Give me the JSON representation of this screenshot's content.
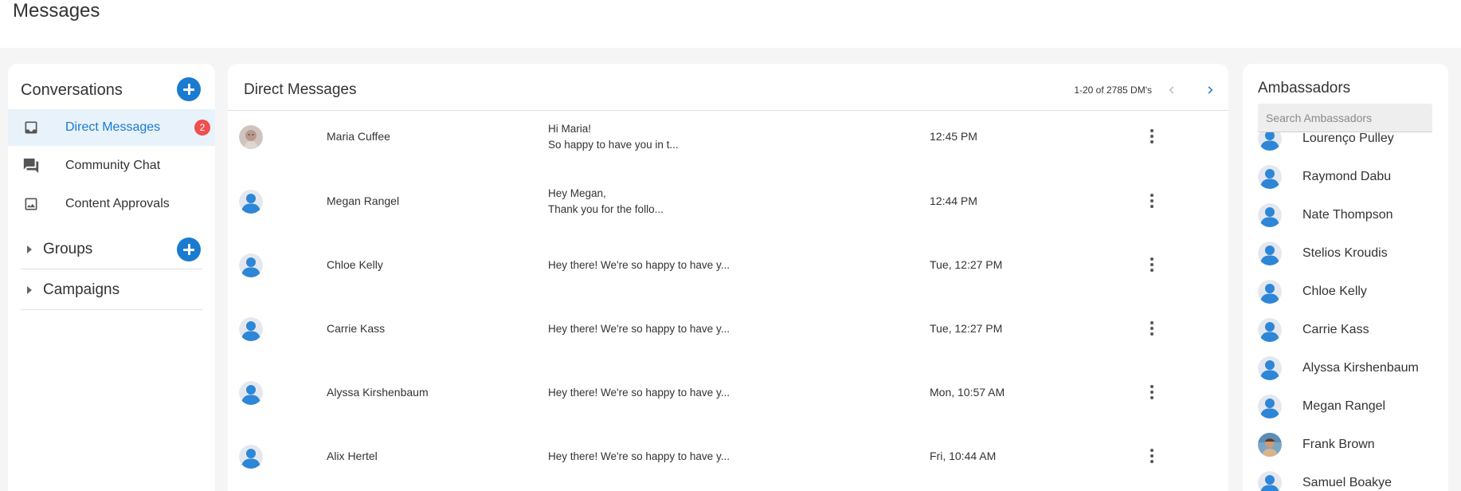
{
  "page": {
    "title": "Messages"
  },
  "conversations": {
    "title": "Conversations",
    "items": [
      {
        "label": "Direct Messages",
        "icon": "inbox-icon",
        "active": true,
        "badge": "2"
      },
      {
        "label": "Community Chat",
        "icon": "forum-icon",
        "active": false
      },
      {
        "label": "Content Approvals",
        "icon": "image-icon",
        "active": false
      }
    ],
    "groups_label": "Groups",
    "campaigns_label": "Campaigns"
  },
  "direct_messages": {
    "title": "Direct Messages",
    "pagination": "1-20 of 2785 DM's",
    "rows": [
      {
        "name": "Maria Cuffee",
        "preview": "Hi Maria!\nSo happy to have you in t...",
        "time": "12:45 PM",
        "avatar": "photo"
      },
      {
        "name": "Megan Rangel",
        "preview": "Hey Megan,\nThank you for the follo...",
        "time": "12:44 PM",
        "avatar": "default"
      },
      {
        "name": "Chloe Kelly",
        "preview": "Hey there! We're so happy to have y...",
        "time": "Tue, 12:27 PM",
        "avatar": "default"
      },
      {
        "name": "Carrie Kass",
        "preview": "Hey there! We're so happy to have y...",
        "time": "Tue, 12:27 PM",
        "avatar": "default"
      },
      {
        "name": "Alyssa Kirshenbaum",
        "preview": "Hey there! We're so happy to have y...",
        "time": "Mon, 10:57 AM",
        "avatar": "default"
      },
      {
        "name": "Alix Hertel",
        "preview": "Hey there! We're so happy to have y...",
        "time": "Fri, 10:44 AM",
        "avatar": "default"
      }
    ]
  },
  "ambassadors": {
    "title": "Ambassadors",
    "search_placeholder": "Search Ambassadors",
    "items": [
      {
        "name": "Lourenço Pulley",
        "avatar": "default"
      },
      {
        "name": "Raymond Dabu",
        "avatar": "default"
      },
      {
        "name": "Nate Thompson",
        "avatar": "default"
      },
      {
        "name": "Stelios Kroudis",
        "avatar": "default"
      },
      {
        "name": "Chloe Kelly",
        "avatar": "default"
      },
      {
        "name": "Carrie Kass",
        "avatar": "default"
      },
      {
        "name": "Alyssa Kirshenbaum",
        "avatar": "default"
      },
      {
        "name": "Megan Rangel",
        "avatar": "default"
      },
      {
        "name": "Frank Brown",
        "avatar": "photo"
      },
      {
        "name": "Samuel Boakye",
        "avatar": "default"
      }
    ]
  },
  "colors": {
    "accent": "#1a7bd0",
    "badge": "#ef4f4f",
    "active_bg": "#e8f2fb"
  }
}
